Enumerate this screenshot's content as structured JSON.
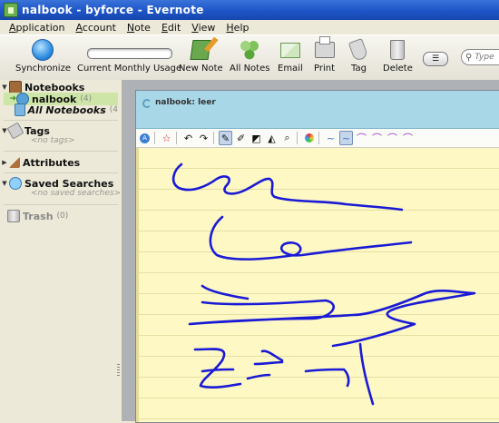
{
  "window": {
    "title": "nalbook - byforce - Evernote"
  },
  "menu": [
    "Application",
    "Account",
    "Note",
    "Edit",
    "View",
    "Help"
  ],
  "toolbar": {
    "synchronize": "Synchronize",
    "usage": "Current Monthly Usage",
    "new_note": "New Note",
    "all_notes": "All Notes",
    "email": "Email",
    "print": "Print",
    "tag": "Tag",
    "delete": "Delete",
    "search_placeholder": "Type"
  },
  "sidebar": {
    "notebooks": {
      "label": "Notebooks",
      "items": [
        {
          "label": "nalbook",
          "count": "(4)"
        },
        {
          "label": "All Notebooks",
          "count": "(4"
        }
      ]
    },
    "tags": {
      "label": "Tags",
      "empty": "<no tags>"
    },
    "attributes": {
      "label": "Attributes"
    },
    "saved_searches": {
      "label": "Saved Searches",
      "empty": "<no saved searches>"
    },
    "trash": {
      "label": "Trash",
      "count": "(0)"
    }
  },
  "note": {
    "title": "nalbook: leer",
    "ink_color": "#1a1ad6",
    "paper_color": "#fdf8c4"
  },
  "colors": {
    "selected_notebook": "#cde6a7",
    "note_header": "#a8d8e8",
    "titlebar": "#2458c8"
  }
}
